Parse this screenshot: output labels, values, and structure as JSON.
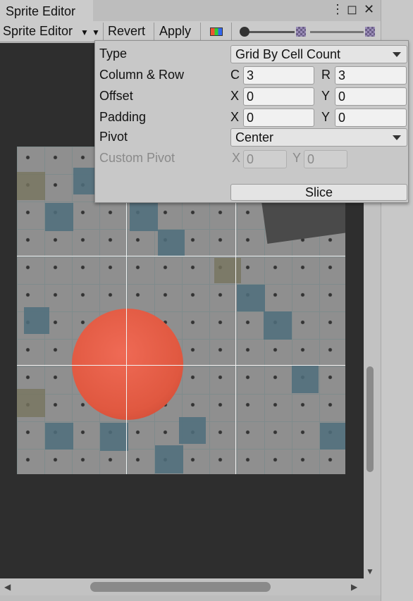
{
  "window": {
    "title": "Sprite Editor"
  },
  "toolbar": {
    "mode_label": "Sprite Editor",
    "revert_label": "Revert",
    "apply_label": "Apply"
  },
  "slice_panel": {
    "type": {
      "label": "Type",
      "value": "Grid By Cell Count"
    },
    "column_row": {
      "label": "Column & Row",
      "c_axis": "C",
      "c_value": "3",
      "r_axis": "R",
      "r_value": "3"
    },
    "offset": {
      "label": "Offset",
      "x_axis": "X",
      "x_value": "0",
      "y_axis": "Y",
      "y_value": "0"
    },
    "padding": {
      "label": "Padding",
      "x_axis": "X",
      "x_value": "0",
      "y_axis": "Y",
      "y_value": "0"
    },
    "pivot": {
      "label": "Pivot",
      "value": "Center"
    },
    "custom_pivot": {
      "label": "Custom Pivot",
      "x_axis": "X",
      "x_value": "0",
      "y_axis": "Y",
      "y_value": "0"
    },
    "slice_label": "Slice"
  },
  "colors": {
    "sprite_circle": "#e05840",
    "grid_line": "#f2f2f2",
    "viewport_bg": "#2e2e2e"
  }
}
